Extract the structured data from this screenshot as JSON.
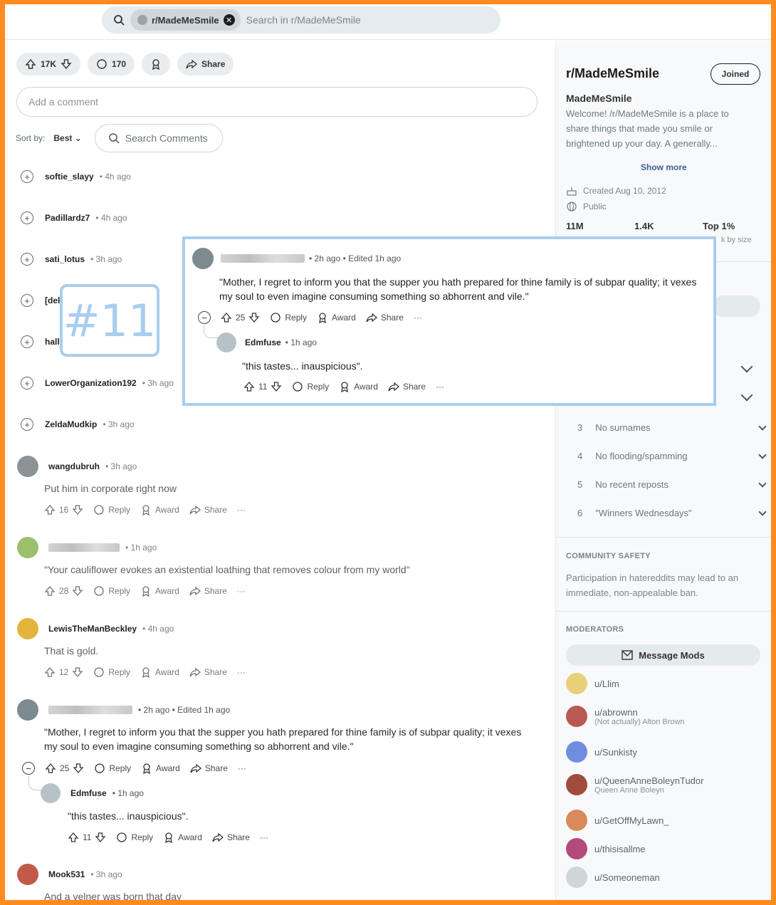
{
  "search": {
    "chip_label": "r/MadeMeSmile",
    "placeholder": "Search in r/MadeMeSmile"
  },
  "post_actions": {
    "votes": "17K",
    "comments": "170",
    "share": "Share"
  },
  "add_comment": "Add a comment",
  "sort": {
    "label": "Sort by:",
    "value": "Best",
    "search_comments": "Search Comments"
  },
  "collapsed_comments": [
    {
      "user": "softie_slayy",
      "time": "• 4h ago"
    },
    {
      "user": "Padillardz7",
      "time": "• 4h ago"
    },
    {
      "user": "sati_lotus",
      "time": "• 3h ago"
    },
    {
      "user": "[del",
      "time": ""
    },
    {
      "user": "hall",
      "time": ""
    },
    {
      "user": "LowerOrganization192",
      "time": "• 3h ago"
    },
    {
      "user": "ZeldaMudkip",
      "time": "• 3h ago"
    }
  ],
  "comments": [
    {
      "user": "wangdubruh",
      "time": "• 3h ago",
      "text": "Put him in corporate right now",
      "votes": "16"
    },
    {
      "user": "",
      "time": "• 1h ago",
      "text": "\"Your cauliflower evokes an existential loathing that removes colour from my world\"",
      "votes": "28"
    },
    {
      "user": "LewisTheManBeckley",
      "time": "• 4h ago",
      "text": "That is gold.",
      "votes": "12"
    },
    {
      "user": "",
      "time": "• 2h ago • Edited 1h ago",
      "text": "\"Mother, I regret to inform you that the supper you hath prepared for thine family is of subpar quality; it vexes my soul to even imagine consuming something so abhorrent and vile.\"",
      "votes": "25"
    }
  ],
  "reply": {
    "user": "Edmfuse",
    "time": "• 1h ago",
    "text": "\"this tastes... inauspicious\".",
    "votes": "11"
  },
  "last_comment": {
    "user": "Mook531",
    "time": "• 3h ago",
    "text": "And a velner was born that day"
  },
  "action_labels": {
    "reply": "Reply",
    "award": "Award",
    "share": "Share",
    "more": "···"
  },
  "badge": "#11",
  "sidebar": {
    "title": "r/MadeMeSmile",
    "joined": "Joined",
    "name": "MadeMeSmile",
    "description": "Welcome! /r/MadeMeSmile is a place to share things that made you smile or brightened up your day. A generally...",
    "show_more": "Show more",
    "created": "Created Aug 10, 2012",
    "visibility": "Public",
    "stats": [
      "11M",
      "1.4K",
      "Top 1%"
    ],
    "rank_note": "k by size",
    "rules": [
      {
        "n": "3",
        "t": "No surnames"
      },
      {
        "n": "4",
        "t": "No flooding/spamming"
      },
      {
        "n": "5",
        "t": "No recent reposts"
      },
      {
        "n": "6",
        "t": "\"Winners Wednesdays\""
      }
    ],
    "safety_heading": "COMMUNITY SAFETY",
    "safety_text": "Participation in hatereddits may lead to an immediate, non-appealable ban.",
    "mods_heading": "MODERATORS",
    "message_mods": "Message Mods",
    "mods": [
      {
        "u": "u/Llim",
        "sub": ""
      },
      {
        "u": "u/abrownn",
        "sub": "(Not actually) Alton Brown"
      },
      {
        "u": "u/Sunkisty",
        "sub": ""
      },
      {
        "u": "u/QueenAnneBoleynTudor",
        "sub": "Queen Anne Boleyn"
      },
      {
        "u": "u/GetOffMyLawn_",
        "sub": ""
      },
      {
        "u": "u/thisisallme",
        "sub": ""
      },
      {
        "u": "u/Someoneman",
        "sub": ""
      }
    ]
  },
  "colors": {
    "frame": "#ff8a1f",
    "highlight": "#a9cdee"
  }
}
